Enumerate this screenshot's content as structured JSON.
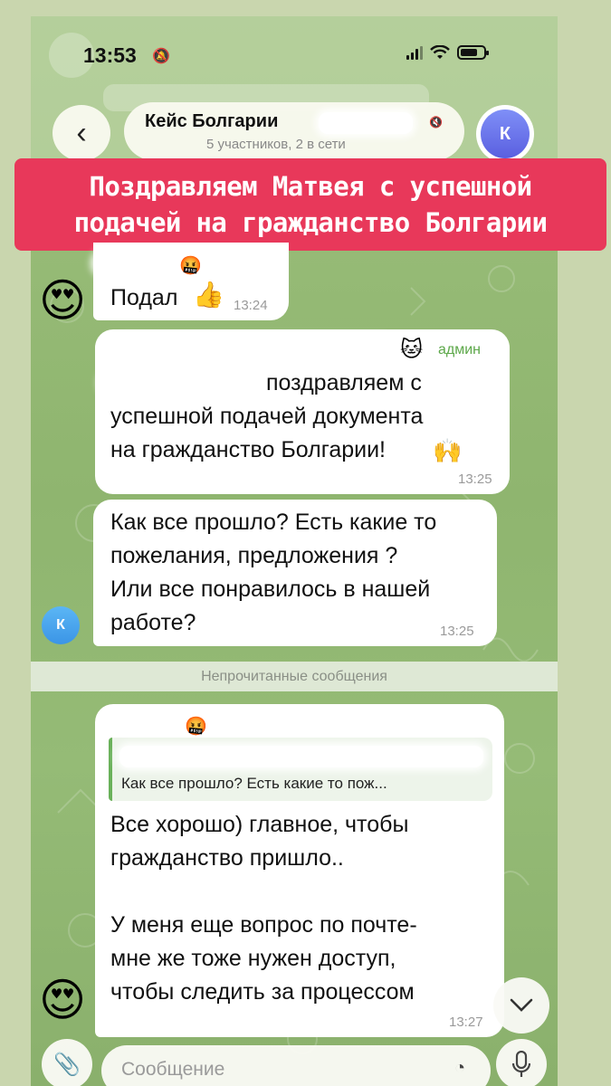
{
  "status": {
    "time": "13:53"
  },
  "header": {
    "back_icon": "chevron-left-icon",
    "chat_title": "Кейс Болгарии",
    "chat_subtitle": "5 участников, 2 в сети",
    "avatar_letter": "К"
  },
  "banner": {
    "line1": "Поздравляем Матвея с успешной",
    "line2": "подачей на гражданство Болгарии"
  },
  "messages": [
    {
      "text": "Подал",
      "emoji": "👍",
      "time": "13:24"
    },
    {
      "admin_label": "админ",
      "line1": "поздравляем с",
      "line2": "успешной подачей документа",
      "line3": "на гражданство Болгарии!",
      "emoji": "🙌",
      "time": "13:25"
    },
    {
      "line1": "Как все прошло? Есть какие то",
      "line2": "пожелания, предложения  ?",
      "line3": "Или все понравилось в нашей",
      "line4": "работе?",
      "time": "13:25",
      "avatar_letter": "К"
    },
    {
      "reply_preview": "Как все прошло? Есть какие то пож...",
      "line1": "Все хорошо) главное, чтобы",
      "line2": "гражданство пришло..",
      "line3": "У меня еще вопрос по почте-",
      "line4": "мне же тоже нужен доступ,",
      "line5": "чтобы следить за процессом",
      "time": "13:27"
    }
  ],
  "unread_divider": "Непрочитанные сообщения",
  "composer": {
    "placeholder": "Сообщение"
  },
  "colors": {
    "banner": "#e8385a",
    "chat_bg": "#8fb56f",
    "admin_green": "#5da84a",
    "avatar_blue": "#3b95e6",
    "avatar_violet": "#5a5fe0"
  }
}
